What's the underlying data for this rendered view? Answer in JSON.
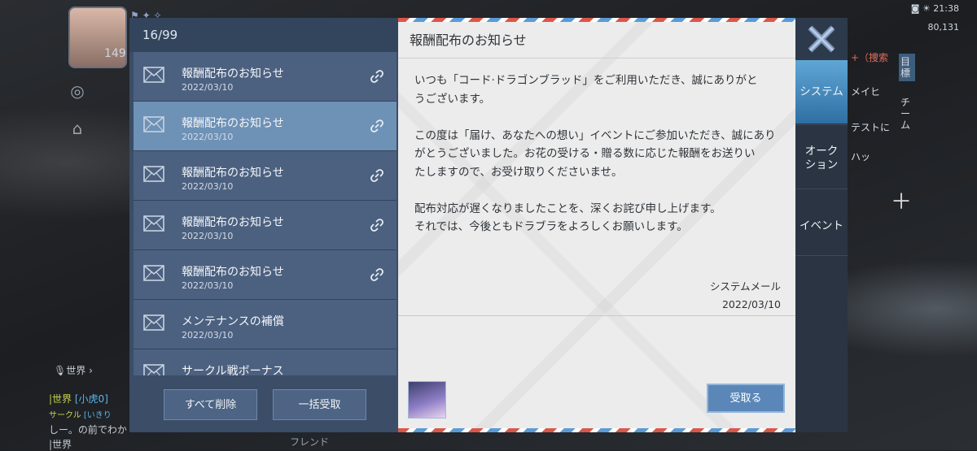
{
  "hud": {
    "level": "149",
    "clock": "21:38",
    "coins": "80,131",
    "right_labels": [
      "+（捜索",
      "メイヒ",
      "テストに",
      "ハッ"
    ],
    "right_badges": [
      "目標",
      "チーム"
    ],
    "world_channel": "世界",
    "chat_lines": [
      {
        "tag": "|世界",
        "name": "[小虎0]",
        "text": ""
      },
      {
        "tag": "サークル",
        "name": "[いきり",
        "text": ""
      },
      {
        "tag": "",
        "name": "",
        "text": "しー。の前でわか"
      },
      {
        "tag": "|世界",
        "name": "",
        "text": ""
      }
    ],
    "friend_label": "フレンド"
  },
  "mail": {
    "counter": "16/99",
    "items": [
      {
        "title": "報酬配布のお知らせ",
        "date": "2022/03/10",
        "has_link": true,
        "selected": false
      },
      {
        "title": "報酬配布のお知らせ",
        "date": "2022/03/10",
        "has_link": true,
        "selected": true
      },
      {
        "title": "報酬配布のお知らせ",
        "date": "2022/03/10",
        "has_link": true,
        "selected": false
      },
      {
        "title": "報酬配布のお知らせ",
        "date": "2022/03/10",
        "has_link": true,
        "selected": false
      },
      {
        "title": "報酬配布のお知らせ",
        "date": "2022/03/10",
        "has_link": true,
        "selected": false
      },
      {
        "title": "メンテナンスの補償",
        "date": "2022/03/10",
        "has_link": false,
        "selected": false
      },
      {
        "title": "サークル戦ボーナス",
        "date": "",
        "has_link": false,
        "selected": false
      }
    ],
    "delete_all_label": "すべて削除",
    "receive_all_label": "一括受取"
  },
  "detail": {
    "title": "報酬配布のお知らせ",
    "body": "いつも「コード·ドラゴンブラッド」をご利用いただき、誠にありがと\nうございます。\n\nこの度は「届け、あなたへの想い」イベントにご参加いただき、誠にあり\nがとうございました。お花の受ける・贈る数に応じた報酬をお送りい\nたしますので、お受け取りくださいませ。\n\n配布対応が遅くなりましたことを、深くお詫び申し上げます。\nそれでは、今後ともドラブラをよろしくお願いします。",
    "sender": "システムメール",
    "date": "2022/03/10",
    "receive_label": "受取る"
  },
  "tabs": [
    {
      "label": "システム",
      "active": true
    },
    {
      "label": "オーク\nション",
      "active": false
    },
    {
      "label": "イベント",
      "active": false
    }
  ],
  "colors": {
    "list_bg": "#3b4d67",
    "item_bg": "#4c6180",
    "item_selected": "#6e91b6",
    "tab_active": "#4b8fc4",
    "receive_button": "#5a87b8"
  }
}
